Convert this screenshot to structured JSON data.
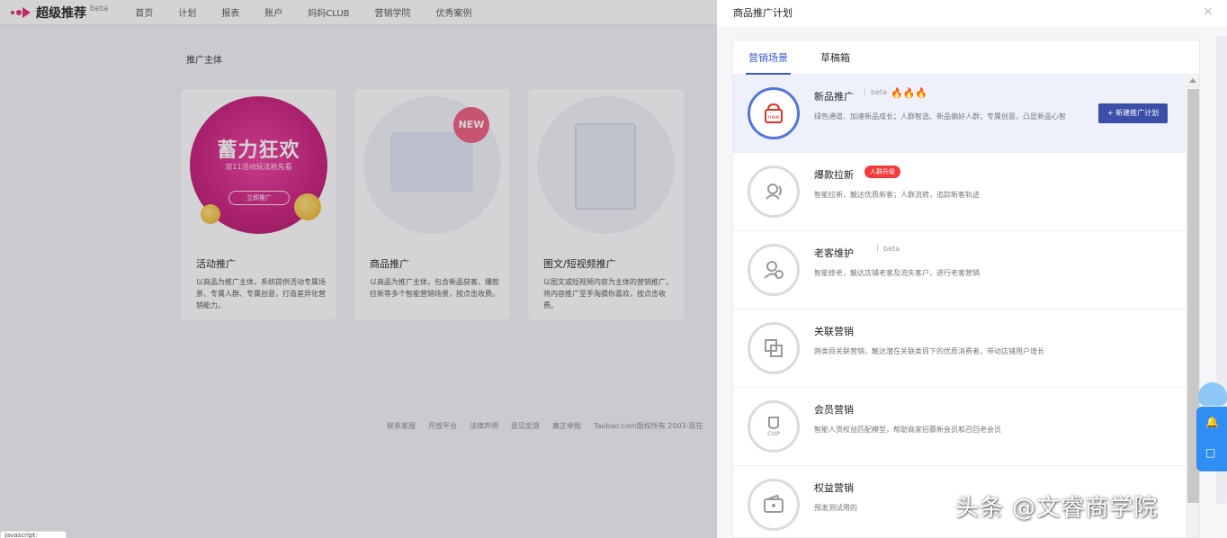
{
  "app": {
    "logo_text": "超级推荐",
    "logo_beta": "beta",
    "nav": [
      "首页",
      "计划",
      "报表",
      "账户",
      "妈妈CLUB",
      "营销学院",
      "优秀案例"
    ]
  },
  "background": {
    "section_title": "推广主体",
    "cards": [
      {
        "title": "活动推广",
        "desc": "以商品为推广主体，系统提供活动专属场景、专属人群、专属创意，打造差异化营销能力。",
        "banner_title": "蓄力狂欢",
        "banner_sub": "双11活动玩法抢先看",
        "banner_btn": "立即推广"
      },
      {
        "title": "商品推广",
        "desc": "以商品为推广主体，包含新品获客、爆款拉新等多个智能营销场景，按点击收费。",
        "badge": "NEW"
      },
      {
        "title": "图文/短视频推广",
        "desc": "以图文或短视频内容为主体的营销推广，将内容推广至手淘猜你喜欢，按点击收费。"
      }
    ],
    "footer_links": [
      "联系客服",
      "开放平台",
      "法律声明",
      "意见反馈",
      "廉正举报",
      "Taobao.com版权所有 2003-现在"
    ],
    "corner_text": "javascript:"
  },
  "drawer": {
    "title": "商品推广计划",
    "close_symbol": "×",
    "tabs": [
      {
        "label": "营销场景",
        "active": true
      },
      {
        "label": "草稿箱",
        "active": false
      }
    ],
    "items": [
      {
        "title": "新品推广",
        "beta": "beta",
        "flames": "🔥🔥🔥",
        "desc": "绿色通道、加速新品成长；人群智选、新品偏好人群；专属创意、凸显新品心智",
        "button": "+ 新建推广计划",
        "icon_label": "new",
        "selected": true
      },
      {
        "title": "爆款拉新",
        "badge": "人群升级",
        "desc": "智能拉新，触达优质新客；人群流转，追踪新客轨迹"
      },
      {
        "title": "老客维护",
        "beta": "beta",
        "desc": "智能修老，触达店铺老客及流失客户，进行老客营销"
      },
      {
        "title": "关联营销",
        "desc": "跨类目关联营销，触达潜在关联类目下的优质消费者，带动店铺用户增长"
      },
      {
        "title": "会员营销",
        "icon_label": "CVIP",
        "desc": "智能人货权益匹配模型，帮助商家招募新会员和召回老会员"
      },
      {
        "title": "权益营销",
        "desc": "预发测试用的"
      }
    ]
  },
  "watermark": "头条 @文睿商学院",
  "colors": {
    "accent": "#3b5bc7",
    "button": "#3b4fa8",
    "badge": "#f33b3b",
    "hot_banner": "#c81a78",
    "float": "#2f8ef3"
  }
}
